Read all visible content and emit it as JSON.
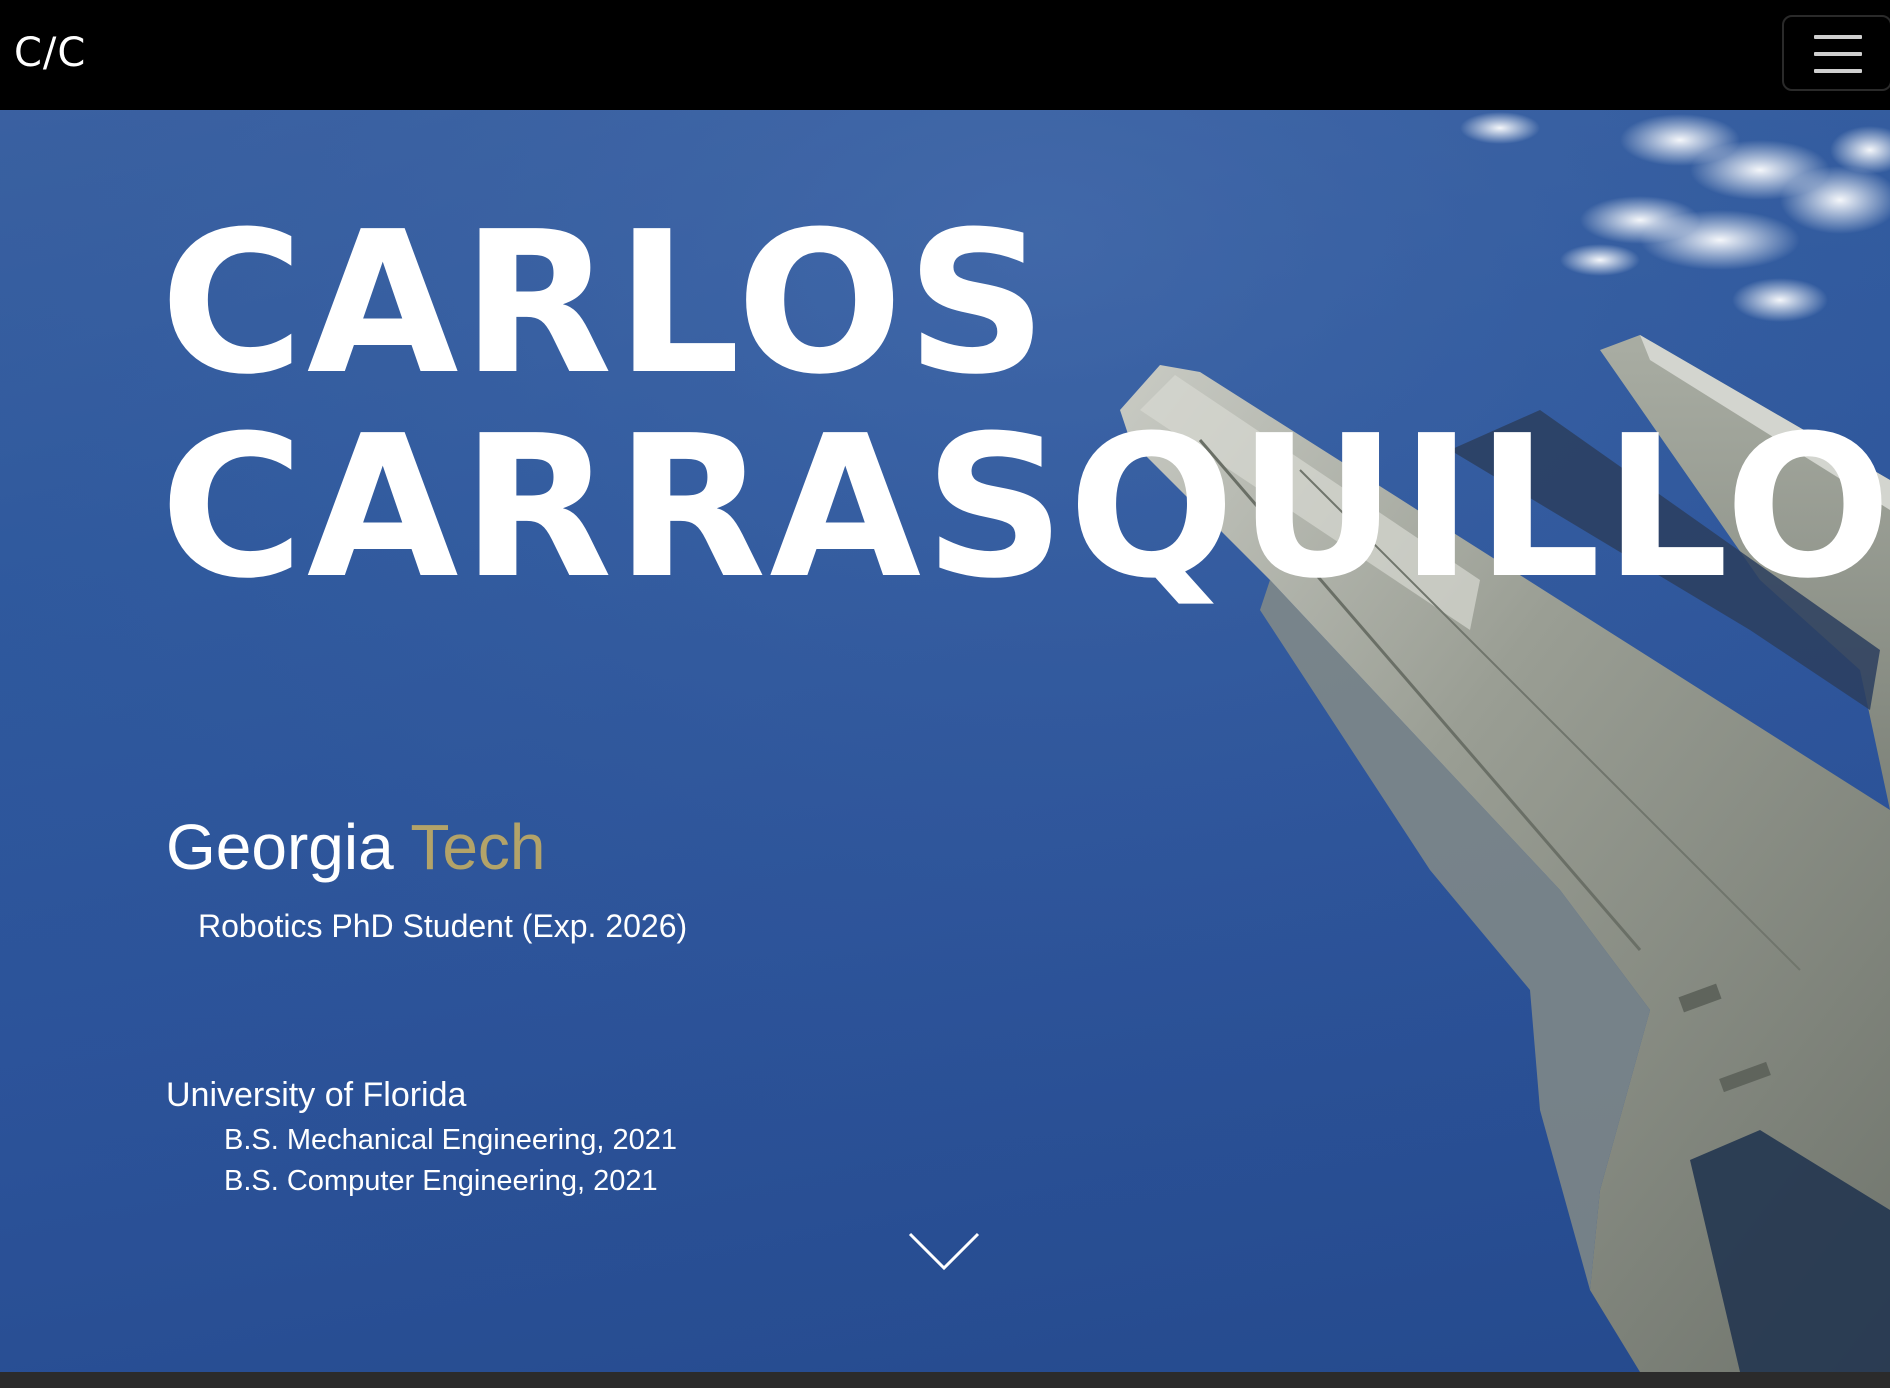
{
  "navbar": {
    "brand": "C/C",
    "menu_icon": "hamburger-menu-icon"
  },
  "hero": {
    "background": "sky-with-jet-wing",
    "name_line1": "CARLOS",
    "name_line2": "CARRASQUILLO",
    "georgia_tech": {
      "word1": "Georgia",
      "word2": "Tech",
      "word2_color": "#b3a369",
      "degree": "Robotics PhD Student (Exp. 2026)"
    },
    "uf": {
      "title": "University of Florida",
      "degrees": [
        "B.S. Mechanical Engineering, 2021",
        "B.S. Computer Engineering, 2021"
      ]
    },
    "scroll_icon": "chevron-down-icon"
  }
}
